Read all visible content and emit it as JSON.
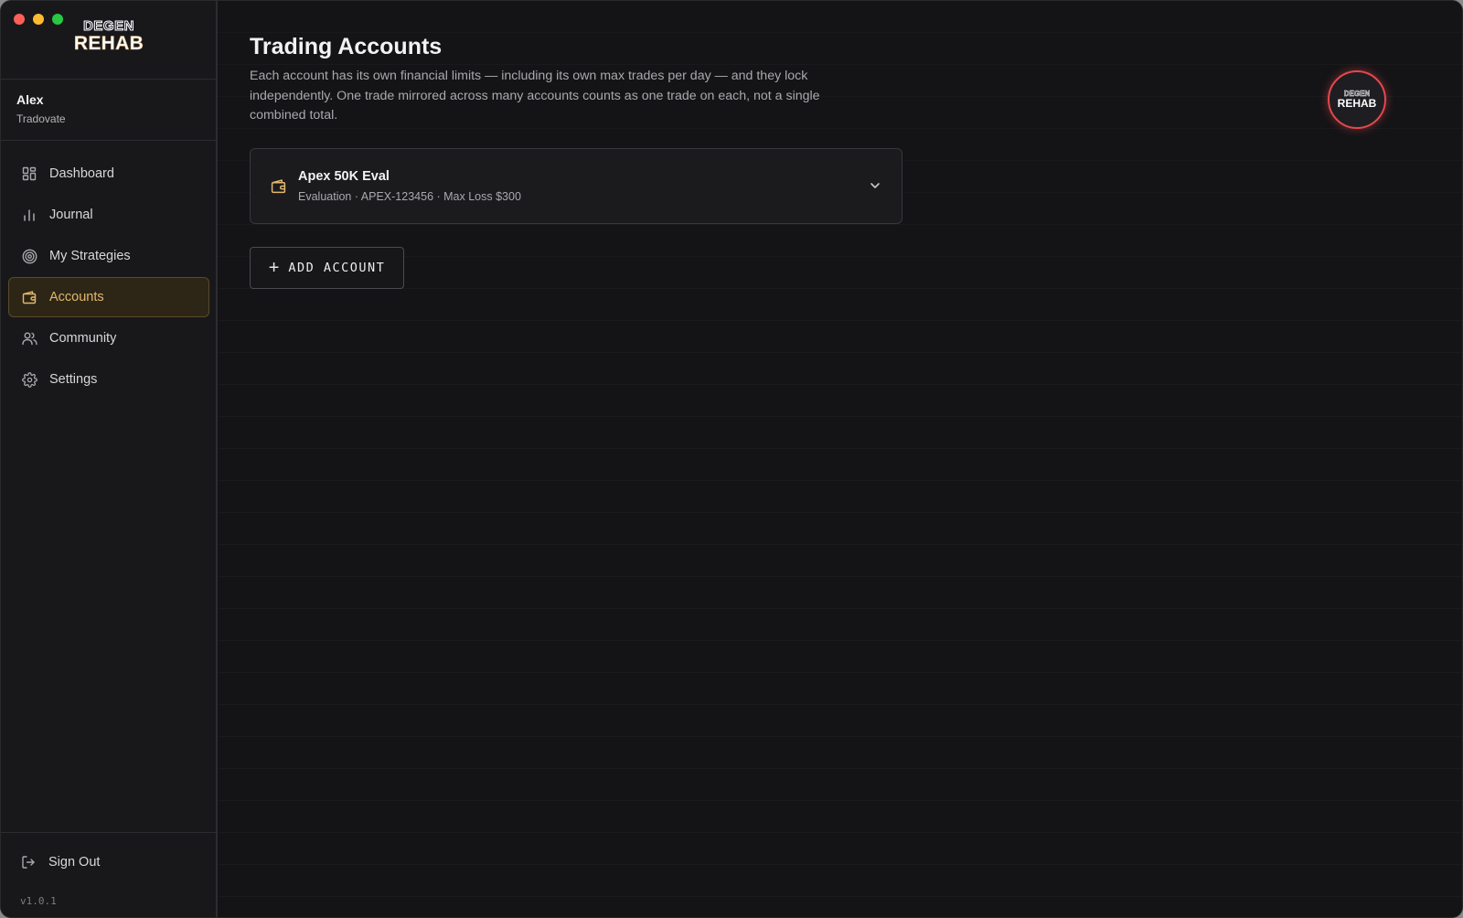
{
  "app": {
    "logo_top": "DEGEN",
    "logo_bottom": "REHAB"
  },
  "user": {
    "name": "Alex",
    "broker": "Tradovate"
  },
  "sidebar": {
    "items": [
      {
        "label": "Dashboard",
        "icon": "grid-icon"
      },
      {
        "label": "Journal",
        "icon": "bar-chart-icon"
      },
      {
        "label": "My Strategies",
        "icon": "target-icon"
      },
      {
        "label": "Accounts",
        "icon": "wallet-icon",
        "active": true
      },
      {
        "label": "Community",
        "icon": "users-icon"
      },
      {
        "label": "Settings",
        "icon": "gear-icon"
      }
    ],
    "sign_out": "Sign Out",
    "version": "v1.0.1"
  },
  "main": {
    "title": "Trading Accounts",
    "description": "Each account has its own financial limits — including its own max trades per day — and they lock independently. One trade mirrored across many accounts counts as one trade on each, not a single combined total.",
    "badge_top": "DEGEN",
    "badge_bottom": "REHAB",
    "accounts": [
      {
        "name": "Apex 50K Eval",
        "meta": "Evaluation · APEX-123456 · Max Loss $300"
      }
    ],
    "add_button": "ADD ACCOUNT"
  },
  "colors": {
    "accent": "#e3b86e",
    "badge_ring": "#e5484d",
    "background": "#141416"
  }
}
